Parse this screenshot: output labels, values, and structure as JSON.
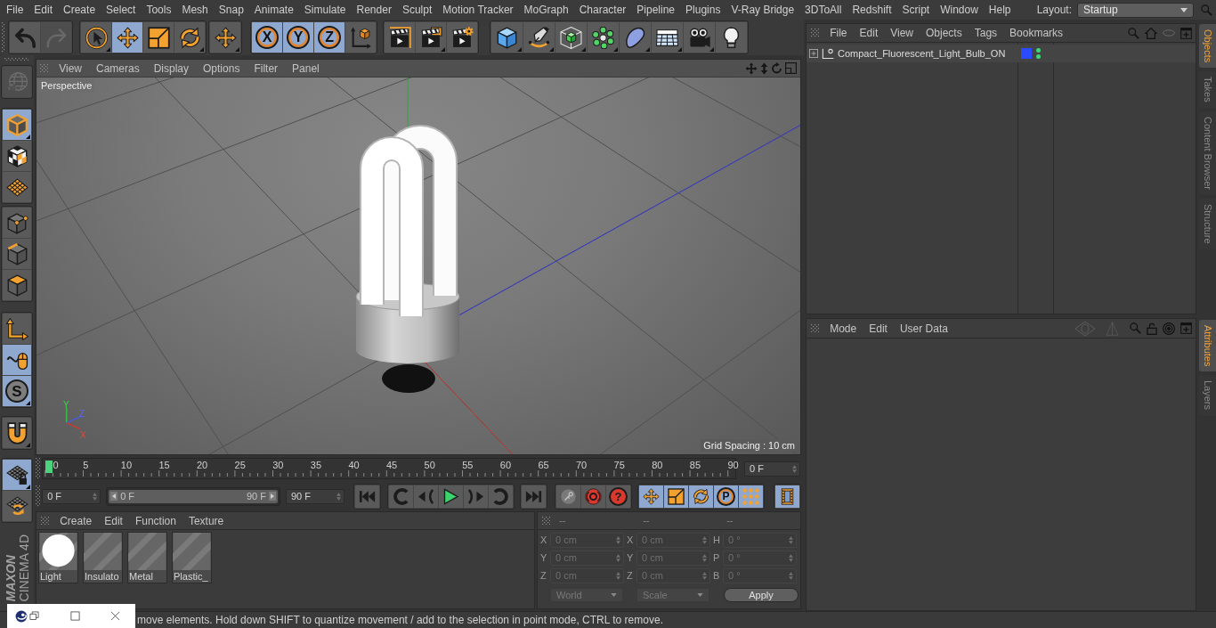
{
  "menu_bar": {
    "items": [
      "File",
      "Edit",
      "Create",
      "Select",
      "Tools",
      "Mesh",
      "Snap",
      "Animate",
      "Simulate",
      "Render",
      "Sculpt",
      "Motion Tracker",
      "MoGraph",
      "Character",
      "Pipeline",
      "Plugins",
      "V-Ray Bridge",
      "3DToAll",
      "Redshift",
      "Script",
      "Window",
      "Help"
    ],
    "layout_label": "Layout:",
    "layout_value": "Startup"
  },
  "toolbar": {
    "groups": [
      {
        "buttons": [
          {
            "kind": "undo",
            "disabled": false,
            "menu": false
          },
          {
            "kind": "redo",
            "disabled": true,
            "menu": false
          }
        ]
      },
      {
        "buttons": [
          {
            "kind": "live-select",
            "selected": false,
            "menu": true
          },
          {
            "kind": "move",
            "selected": true,
            "menu": false
          },
          {
            "kind": "scale",
            "selected": false,
            "menu": false
          },
          {
            "kind": "rotate",
            "selected": false,
            "menu": true
          }
        ]
      },
      {
        "buttons": [
          {
            "kind": "recent-move",
            "selected": false,
            "menu": true
          }
        ]
      },
      {
        "buttons": [
          {
            "kind": "x-axis",
            "label": "X",
            "selected": true,
            "menu": false
          },
          {
            "kind": "y-axis",
            "label": "Y",
            "selected": true,
            "menu": false
          },
          {
            "kind": "z-axis",
            "label": "Z",
            "selected": true,
            "menu": false
          },
          {
            "kind": "coordinate-system",
            "selected": false,
            "menu": false
          }
        ]
      },
      {
        "buttons": [
          {
            "kind": "render-view",
            "selected": false,
            "menu": false
          },
          {
            "kind": "render-picture",
            "selected": false,
            "menu": true
          },
          {
            "kind": "render-settings",
            "selected": false,
            "menu": false
          }
        ]
      },
      {
        "buttons": [
          {
            "kind": "cube",
            "selected": false,
            "menu": true
          },
          {
            "kind": "pen",
            "selected": false,
            "menu": true
          },
          {
            "kind": "subdivision",
            "selected": false,
            "menu": true
          },
          {
            "kind": "cloner",
            "selected": false,
            "menu": true
          },
          {
            "kind": "deformer",
            "selected": false,
            "menu": true
          },
          {
            "kind": "floor",
            "selected": false,
            "menu": true
          },
          {
            "kind": "camera",
            "selected": false,
            "menu": true
          },
          {
            "kind": "light",
            "selected": false,
            "menu": false
          }
        ]
      }
    ]
  },
  "left_toolbar": {
    "groups": [
      {
        "buttons": [
          {
            "kind": "make-editable",
            "disabled": true,
            "menu": false
          }
        ]
      },
      {
        "buttons": [
          {
            "kind": "model",
            "selected": true,
            "menu": true
          },
          {
            "kind": "texture",
            "selected": false,
            "menu": false
          },
          {
            "kind": "workplane",
            "selected": false,
            "menu": false
          }
        ]
      },
      {
        "buttons": [
          {
            "kind": "points",
            "selected": false,
            "menu": false
          },
          {
            "kind": "edges",
            "selected": false,
            "menu": false
          },
          {
            "kind": "polygons",
            "selected": false,
            "menu": false
          }
        ]
      },
      {
        "buttons": [
          {
            "kind": "axis",
            "selected": false,
            "menu": false
          },
          {
            "kind": "tweak",
            "selected": true,
            "menu": false
          },
          {
            "kind": "solo",
            "label": "S",
            "selected": true,
            "menu": true
          }
        ]
      },
      {
        "buttons": [
          {
            "kind": "snap",
            "selected": false,
            "menu": true
          }
        ]
      },
      {
        "buttons": [
          {
            "kind": "workplane-lock",
            "selected": true,
            "menu": true
          },
          {
            "kind": "workplane-align",
            "selected": false,
            "menu": false
          }
        ]
      }
    ]
  },
  "logo": {
    "brand": "MAXON",
    "product": "CINEMA 4D"
  },
  "viewport": {
    "menu": [
      "View",
      "Cameras",
      "Display",
      "Options",
      "Filter",
      "Panel"
    ],
    "camera": "Perspective",
    "grid_spacing": "Grid Spacing : 10 cm",
    "axis_labels": {
      "y": "Y",
      "z": "Z",
      "x": "X"
    }
  },
  "timeline": {
    "frames": [
      "0",
      "5",
      "10",
      "15",
      "20",
      "25",
      "30",
      "35",
      "40",
      "45",
      "50",
      "55",
      "60",
      "65",
      "70",
      "75",
      "80",
      "85",
      "90"
    ],
    "level": 0,
    "current_frame": "0 F"
  },
  "transport": {
    "start_field": "0 F",
    "range": {
      "start": "0 F",
      "end": "90 F",
      "level": 1
    },
    "end_field": "90 F",
    "groups": [
      [
        {
          "kind": "go-start"
        }
      ],
      [
        {
          "kind": "prev-key"
        },
        {
          "kind": "prev-frame"
        },
        {
          "kind": "play"
        },
        {
          "kind": "next-frame"
        },
        {
          "kind": "next-key"
        }
      ],
      [
        {
          "kind": "go-end"
        }
      ],
      [
        {
          "kind": "key-off"
        },
        {
          "kind": "record"
        },
        {
          "kind": "autokey",
          "label": "?"
        }
      ],
      [
        {
          "kind": "move",
          "selected": true
        },
        {
          "kind": "scale",
          "selected": true
        },
        {
          "kind": "rotate",
          "selected": true
        },
        {
          "kind": "parameter",
          "label": "P",
          "selected": true
        },
        {
          "kind": "dots",
          "selected": true
        }
      ],
      [
        {
          "kind": "film",
          "selected": true
        }
      ]
    ]
  },
  "materials": {
    "menu": [
      "Create",
      "Edit",
      "Function",
      "Texture"
    ],
    "items": [
      {
        "name": "Light",
        "kind": "sphere"
      },
      {
        "name": "Insulato",
        "kind": "blank"
      },
      {
        "name": "Metal",
        "kind": "blank"
      },
      {
        "name": "Plastic_",
        "kind": "blank"
      }
    ]
  },
  "coordinates": {
    "disabled": true,
    "headers": [
      "--",
      "--",
      "--"
    ],
    "rows": [
      [
        {
          "label": "X",
          "value": "0 cm"
        },
        {
          "label": "X",
          "value": "0 cm"
        },
        {
          "label": "H",
          "value": "0 °"
        }
      ],
      [
        {
          "label": "Y",
          "value": "0 cm"
        },
        {
          "label": "Y",
          "value": "0 cm"
        },
        {
          "label": "P",
          "value": "0 °"
        }
      ],
      [
        {
          "label": "Z",
          "value": "0 cm"
        },
        {
          "label": "Z",
          "value": "0 cm"
        },
        {
          "label": "B",
          "value": "0 °"
        }
      ]
    ],
    "dropdowns": [
      "World",
      "Scale"
    ],
    "apply_button": "Apply"
  },
  "object_manager": {
    "menu": [
      "File",
      "Edit",
      "View",
      "Objects",
      "Tags",
      "Bookmarks"
    ],
    "objects": [
      {
        "name": "Compact_Fluorescent_Light_Bulb_ON",
        "expanded": false,
        "color": "#2b4bff",
        "editor_visible": true,
        "render_visible": true
      }
    ]
  },
  "attribute_manager": {
    "menu": [
      "Mode",
      "Edit",
      "User Data"
    ]
  },
  "side_tabs": {
    "upper": [
      {
        "label": "Objects",
        "selected": true
      },
      {
        "label": "Takes",
        "selected": false
      },
      {
        "label": "Content Browser",
        "selected": false
      },
      {
        "label": "Structure",
        "selected": false
      }
    ],
    "lower": [
      {
        "label": "Attributes",
        "selected": true
      },
      {
        "label": "Layers",
        "selected": false
      }
    ]
  },
  "status_bar": {
    "text": "move elements. Hold down SHIFT to quantize movement / add to the selection in point mode, CTRL to remove."
  }
}
